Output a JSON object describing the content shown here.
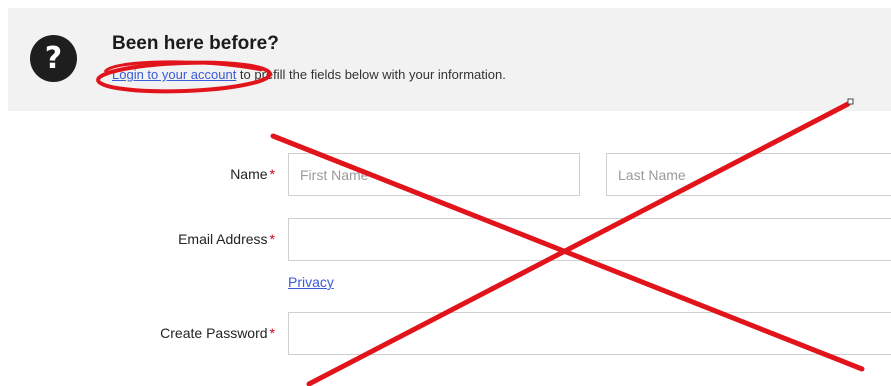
{
  "banner": {
    "title": "Been here before?",
    "login_link": "Login to your account",
    "text_rest": " to prefill the fields below with your information."
  },
  "form": {
    "name": {
      "label": "Name",
      "required_mark": "*",
      "first_placeholder": "First Name",
      "last_placeholder": "Last Name"
    },
    "email": {
      "label": "Email Address",
      "required_mark": "*",
      "value": ""
    },
    "privacy_link": "Privacy",
    "password": {
      "label": "Create Password",
      "required_mark": "*",
      "value": ""
    }
  },
  "icons": {
    "help": "question-mark-icon",
    "help_glyph": "?"
  },
  "colors": {
    "link": "#3a5bd9",
    "required": "#d0021b",
    "annotation": "#e2141b",
    "banner_bg": "#f2f2f2"
  }
}
